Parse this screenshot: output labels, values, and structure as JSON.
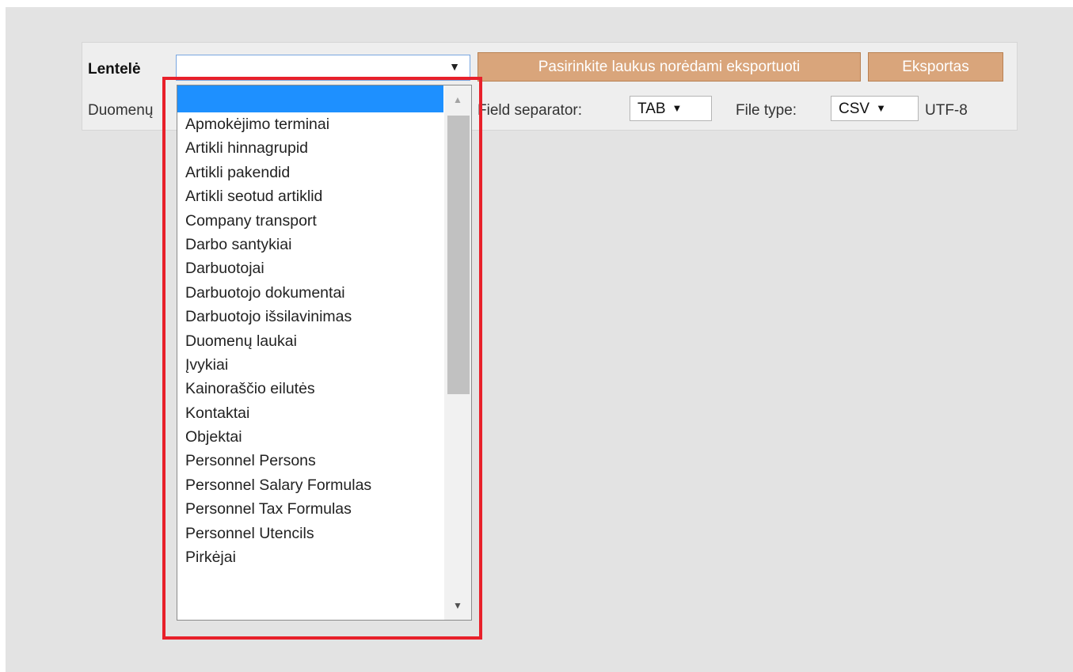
{
  "form": {
    "table_label": "Lentelė",
    "fields_button": "Pasirinkite laukus norėdami eksportuoti",
    "export_button": "Eksportas",
    "data_label": "Duomenų",
    "separator_label": "Field separator:",
    "separator_value": "TAB",
    "filetype_label": "File type:",
    "filetype_value": "CSV",
    "encoding": "UTF-8",
    "arrow": "▼"
  },
  "dropdown": {
    "selected": "",
    "items": [
      "",
      "Apmokėjimo terminai",
      "Artikli hinnagrupid",
      "Artikli pakendid",
      "Artikli seotud artiklid",
      "Company transport",
      "Darbo santykiai",
      "Darbuotojai",
      "Darbuotojo dokumentai",
      "Darbuotojo išsilavinimas",
      "Duomenų laukai",
      "Įvykiai",
      "Kainoraščio eilutės",
      "Kontaktai",
      "Objektai",
      "Personnel Persons",
      "Personnel Salary Formulas",
      "Personnel Tax Formulas",
      "Personnel Utencils",
      "Pirkėjai"
    ]
  },
  "colors": {
    "button": "#d9a57b",
    "selected_item": "#1e90ff",
    "highlight_box": "#e8202a"
  }
}
